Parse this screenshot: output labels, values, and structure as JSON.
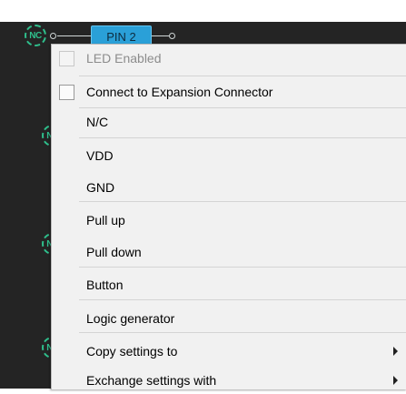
{
  "pin": {
    "label": "PIN 2"
  },
  "nc_label": "NC",
  "menu": {
    "items": [
      {
        "label": "LED Enabled",
        "checkbox": true,
        "disabled": true
      },
      {
        "label": "Connect to Expansion Connector",
        "checkbox": true
      },
      {
        "label": "N/C"
      },
      {
        "label": "VDD"
      },
      {
        "label": "GND"
      },
      {
        "label": "Pull up"
      },
      {
        "label": "Pull down"
      },
      {
        "label": "Button"
      },
      {
        "label": "Logic generator"
      },
      {
        "label": "Copy settings to",
        "submenu": true
      },
      {
        "label": "Exchange settings with",
        "submenu": true
      }
    ]
  },
  "colors": {
    "background": "#242424",
    "nc_icon": "#2fbf8c",
    "pin_badge": "#2aa0d8",
    "menu_bg": "#f1f1f1"
  }
}
